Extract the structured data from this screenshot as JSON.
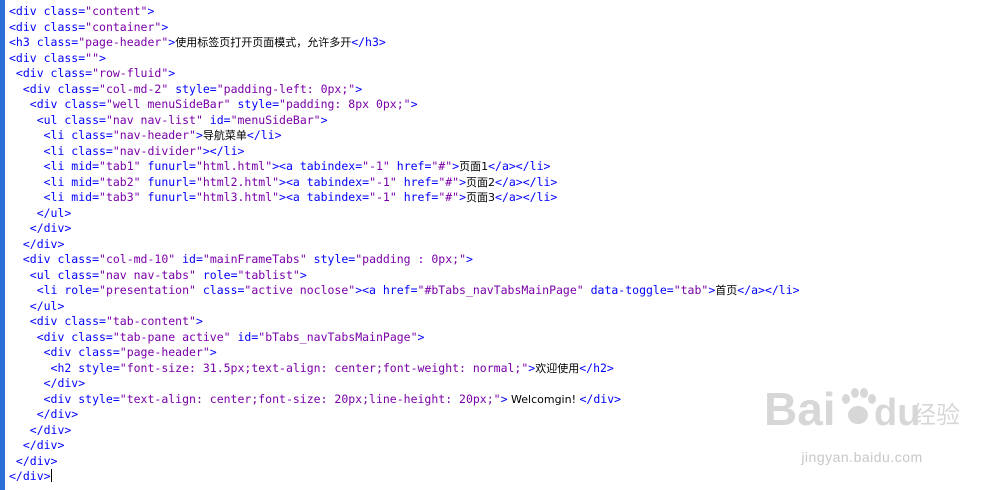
{
  "colors": {
    "tag": "#0000ff",
    "string": "#7a00a8",
    "text": "#000000",
    "gutter": "#2b6fd6"
  },
  "code_lines": [
    [
      {
        "c": "t",
        "s": "<div class="
      },
      {
        "c": "s",
        "s": "\"content\""
      },
      {
        "c": "t",
        "s": ">"
      }
    ],
    [
      {
        "c": "t",
        "s": "<div class="
      },
      {
        "c": "s",
        "s": "\"container\""
      },
      {
        "c": "t",
        "s": ">"
      }
    ],
    [
      {
        "c": "t",
        "s": "<h3 class="
      },
      {
        "c": "s",
        "s": "\"page-header\""
      },
      {
        "c": "t",
        "s": ">"
      },
      {
        "c": "x",
        "s": "使用标签页打开页面模式，允许多开"
      },
      {
        "c": "t",
        "s": "</h3>"
      }
    ],
    [
      {
        "c": "t",
        "s": "<div class="
      },
      {
        "c": "s",
        "s": "\"\""
      },
      {
        "c": "t",
        "s": ">"
      }
    ],
    [
      {
        "c": "t",
        "s": " <div class="
      },
      {
        "c": "s",
        "s": "\"row-fluid\""
      },
      {
        "c": "t",
        "s": ">"
      }
    ],
    [
      {
        "c": "t",
        "s": "  <div class="
      },
      {
        "c": "s",
        "s": "\"col-md-2\""
      },
      {
        "c": "t",
        "s": " style="
      },
      {
        "c": "s",
        "s": "\"padding-left: 0px;\""
      },
      {
        "c": "t",
        "s": ">"
      }
    ],
    [
      {
        "c": "t",
        "s": "   <div class="
      },
      {
        "c": "s",
        "s": "\"well menuSideBar\""
      },
      {
        "c": "t",
        "s": " style="
      },
      {
        "c": "s",
        "s": "\"padding: 8px 0px;\""
      },
      {
        "c": "t",
        "s": ">"
      }
    ],
    [
      {
        "c": "t",
        "s": "    <ul class="
      },
      {
        "c": "s",
        "s": "\"nav nav-list\""
      },
      {
        "c": "t",
        "s": " id="
      },
      {
        "c": "s",
        "s": "\"menuSideBar\""
      },
      {
        "c": "t",
        "s": ">"
      }
    ],
    [
      {
        "c": "t",
        "s": "     <li class="
      },
      {
        "c": "s",
        "s": "\"nav-header\""
      },
      {
        "c": "t",
        "s": ">"
      },
      {
        "c": "x",
        "s": "导航菜单"
      },
      {
        "c": "t",
        "s": "</li>"
      }
    ],
    [
      {
        "c": "t",
        "s": "     <li class="
      },
      {
        "c": "s",
        "s": "\"nav-divider\""
      },
      {
        "c": "t",
        "s": "></li>"
      }
    ],
    [
      {
        "c": "t",
        "s": "     <li mid="
      },
      {
        "c": "s",
        "s": "\"tab1\""
      },
      {
        "c": "t",
        "s": " funurl="
      },
      {
        "c": "s",
        "s": "\"html.html\""
      },
      {
        "c": "t",
        "s": "><a tabindex="
      },
      {
        "c": "s",
        "s": "\"-1\""
      },
      {
        "c": "t",
        "s": " href="
      },
      {
        "c": "s",
        "s": "\"#\""
      },
      {
        "c": "t",
        "s": ">"
      },
      {
        "c": "x",
        "s": "页面1"
      },
      {
        "c": "t",
        "s": "</a></li>"
      }
    ],
    [
      {
        "c": "t",
        "s": "     <li mid="
      },
      {
        "c": "s",
        "s": "\"tab2\""
      },
      {
        "c": "t",
        "s": " funurl="
      },
      {
        "c": "s",
        "s": "\"html2.html\""
      },
      {
        "c": "t",
        "s": "><a tabindex="
      },
      {
        "c": "s",
        "s": "\"-1\""
      },
      {
        "c": "t",
        "s": " href="
      },
      {
        "c": "s",
        "s": "\"#\""
      },
      {
        "c": "t",
        "s": ">"
      },
      {
        "c": "x",
        "s": "页面2"
      },
      {
        "c": "t",
        "s": "</a></li>"
      }
    ],
    [
      {
        "c": "t",
        "s": "     <li mid="
      },
      {
        "c": "s",
        "s": "\"tab3\""
      },
      {
        "c": "t",
        "s": " funurl="
      },
      {
        "c": "s",
        "s": "\"html3.html\""
      },
      {
        "c": "t",
        "s": "><a tabindex="
      },
      {
        "c": "s",
        "s": "\"-1\""
      },
      {
        "c": "t",
        "s": " href="
      },
      {
        "c": "s",
        "s": "\"#\""
      },
      {
        "c": "t",
        "s": ">"
      },
      {
        "c": "x",
        "s": "页面3"
      },
      {
        "c": "t",
        "s": "</a></li>"
      }
    ],
    [
      {
        "c": "t",
        "s": "    </ul>"
      }
    ],
    [
      {
        "c": "t",
        "s": "   </div>"
      }
    ],
    [
      {
        "c": "t",
        "s": "  </div>"
      }
    ],
    [
      {
        "c": "t",
        "s": "  <div class="
      },
      {
        "c": "s",
        "s": "\"col-md-10\""
      },
      {
        "c": "t",
        "s": " id="
      },
      {
        "c": "s",
        "s": "\"mainFrameTabs\""
      },
      {
        "c": "t",
        "s": " style="
      },
      {
        "c": "s",
        "s": "\"padding : 0px;\""
      },
      {
        "c": "t",
        "s": ">"
      }
    ],
    [
      {
        "c": "t",
        "s": "   <ul class="
      },
      {
        "c": "s",
        "s": "\"nav nav-tabs\""
      },
      {
        "c": "t",
        "s": " role="
      },
      {
        "c": "s",
        "s": "\"tablist\""
      },
      {
        "c": "t",
        "s": ">"
      }
    ],
    [
      {
        "c": "t",
        "s": "    <li role="
      },
      {
        "c": "s",
        "s": "\"presentation\""
      },
      {
        "c": "t",
        "s": " class="
      },
      {
        "c": "s",
        "s": "\"active noclose\""
      },
      {
        "c": "t",
        "s": "><a href="
      },
      {
        "c": "s",
        "s": "\"#bTabs_navTabsMainPage\""
      },
      {
        "c": "t",
        "s": " data-toggle="
      },
      {
        "c": "s",
        "s": "\"tab\""
      },
      {
        "c": "t",
        "s": ">"
      },
      {
        "c": "x",
        "s": "首页"
      },
      {
        "c": "t",
        "s": "</a></li>"
      }
    ],
    [
      {
        "c": "t",
        "s": "   </ul>"
      }
    ],
    [
      {
        "c": "t",
        "s": "   <div class="
      },
      {
        "c": "s",
        "s": "\"tab-content\""
      },
      {
        "c": "t",
        "s": ">"
      }
    ],
    [
      {
        "c": "t",
        "s": "    <div class="
      },
      {
        "c": "s",
        "s": "\"tab-pane active\""
      },
      {
        "c": "t",
        "s": " id="
      },
      {
        "c": "s",
        "s": "\"bTabs_navTabsMainPage\""
      },
      {
        "c": "t",
        "s": ">"
      }
    ],
    [
      {
        "c": "t",
        "s": "     <div class="
      },
      {
        "c": "s",
        "s": "\"page-header\""
      },
      {
        "c": "t",
        "s": ">"
      }
    ],
    [
      {
        "c": "t",
        "s": "      <h2 style="
      },
      {
        "c": "s",
        "s": "\"font-size: 31.5px;text-align: center;font-weight: normal;\""
      },
      {
        "c": "t",
        "s": ">"
      },
      {
        "c": "x",
        "s": "欢迎使用"
      },
      {
        "c": "t",
        "s": "</h2>"
      }
    ],
    [
      {
        "c": "t",
        "s": "     </div>"
      }
    ],
    [
      {
        "c": "t",
        "s": "     <div style="
      },
      {
        "c": "s",
        "s": "\"text-align: center;font-size: 20px;line-height: 20px;\""
      },
      {
        "c": "t",
        "s": ">"
      },
      {
        "c": "x",
        "s": " Welcomgin! "
      },
      {
        "c": "t",
        "s": "</div>"
      }
    ],
    [
      {
        "c": "t",
        "s": "    </div>"
      }
    ],
    [
      {
        "c": "t",
        "s": "   </div>"
      }
    ],
    [
      {
        "c": "t",
        "s": "  </div>"
      }
    ],
    [
      {
        "c": "t",
        "s": " </div>"
      }
    ],
    [
      {
        "c": "t",
        "s": "</div>"
      }
    ]
  ],
  "watermark": {
    "logo_text": "Bai",
    "logo_text2": "du",
    "brand_cn": "经验",
    "url": "jingyan.baidu.com"
  }
}
